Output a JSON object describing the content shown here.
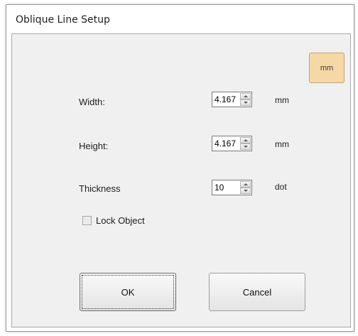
{
  "window": {
    "title": "Oblique Line Setup"
  },
  "unit_toggle": {
    "label": "mm"
  },
  "fields": [
    {
      "label": "Width:",
      "value": "4.167",
      "unit": "mm"
    },
    {
      "label": "Height:",
      "value": "4.167",
      "unit": "mm"
    },
    {
      "label": "Thickness",
      "value": "10",
      "unit": "dot"
    }
  ],
  "lock_object": {
    "label": "Lock Object",
    "checked": false
  },
  "buttons": {
    "ok_label": "OK",
    "cancel_label": "Cancel"
  },
  "colors": {
    "unit_button_bg": "#f5d8a6",
    "client_bg": "#f0f0f0"
  }
}
